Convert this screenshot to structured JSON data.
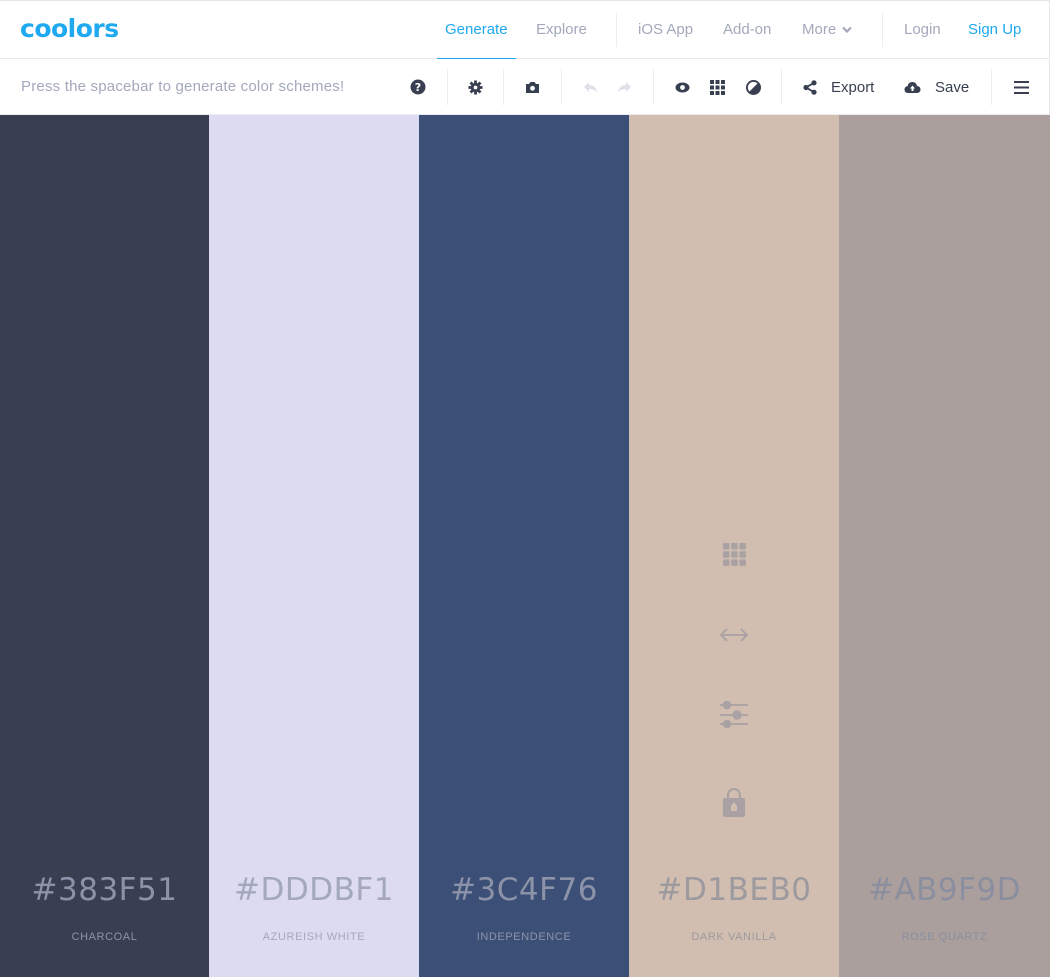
{
  "header": {
    "logo": "coolors",
    "nav": [
      {
        "label": "Generate",
        "active": true
      },
      {
        "label": "Explore"
      },
      {
        "label": "iOS App"
      },
      {
        "label": "Add-on"
      },
      {
        "label": "More"
      },
      {
        "label": "Login"
      },
      {
        "label": "Sign Up"
      }
    ],
    "accent_color": "#1FA9F0"
  },
  "toolbar": {
    "hint": "Press the spacebar to generate color schemes!",
    "icons": [
      "help-icon",
      "settings-icon",
      "camera-icon",
      "undo-icon",
      "redo-icon",
      "view-icon",
      "grid-icon",
      "contrast-icon",
      "share-icon",
      "cloud-upload-icon",
      "menu-icon"
    ],
    "export_label": "Export",
    "save_label": "Save"
  },
  "palette": {
    "swatches": [
      {
        "hex": "#383F51",
        "name": "CHARCOAL",
        "color": "#383F51",
        "text_color": "#8C93A8"
      },
      {
        "hex": "#DDDBF1",
        "name": "AZUREISH WHITE",
        "color": "#DDDBF1",
        "text_color": "#A3A8BB"
      },
      {
        "hex": "#3C4F76",
        "name": "INDEPENDENCE",
        "color": "#3C4F76",
        "text_color": "#8C93A8"
      },
      {
        "hex": "#D1BEB0",
        "name": "DARK VANILLA",
        "color": "#D1BEB0",
        "text_color": "#9C9A9F",
        "hovered": true
      },
      {
        "hex": "#AB9F9D",
        "name": "ROSE QUARTZ",
        "color": "#AB9F9D",
        "text_color": "#8A8E9E"
      }
    ],
    "swatch_tools": [
      "view-shades-icon",
      "drag-icon",
      "adjust-icon",
      "lock-icon"
    ]
  }
}
